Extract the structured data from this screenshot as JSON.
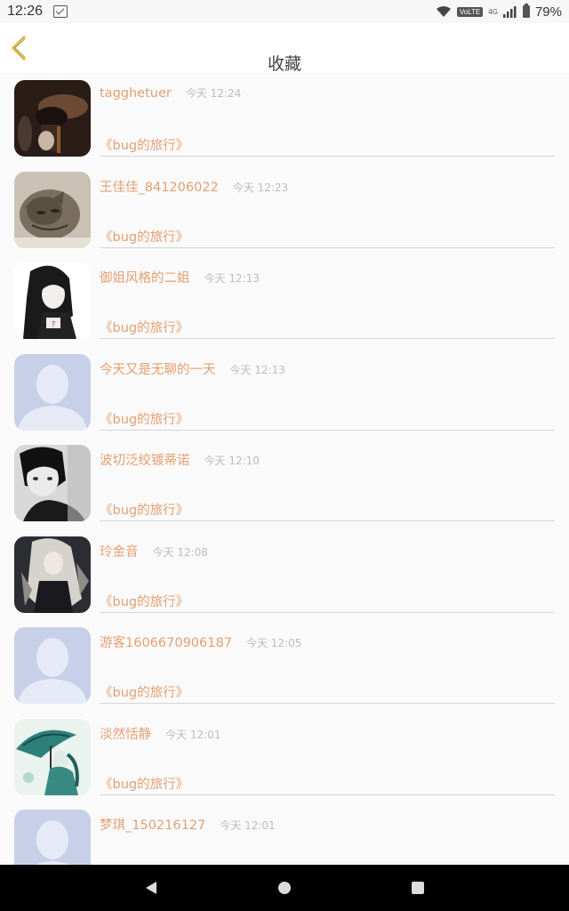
{
  "status_bar": {
    "time": "12:26",
    "volte": "VoLTE",
    "network": "4G",
    "battery": "79%",
    "icons": [
      "notification-icon",
      "wifi-icon",
      "signal-icon",
      "battery-icon"
    ]
  },
  "header": {
    "title": "收藏",
    "back_icon": "chevron-left-icon",
    "accent_color": "#d9b84a"
  },
  "colors": {
    "name_text": "#e3a073",
    "time_text": "#bdbdbd",
    "divider": "#d6d6d6",
    "background": "#fafafa"
  },
  "items": [
    {
      "name": "tagghetuer",
      "time": "今天 12:24",
      "book": "《bug的旅行》",
      "avatar": "dark-photo-avatar"
    },
    {
      "name": "王佳佳_841206022",
      "time": "今天 12:23",
      "book": "《bug的旅行》",
      "avatar": "cat-photo-avatar"
    },
    {
      "name": "御姐风格的二姐",
      "time": "今天 12:13",
      "book": "《bug的旅行》",
      "avatar": "anime-girl-avatar"
    },
    {
      "name": "今天又是无聊的一天",
      "time": "今天 12:13",
      "book": "《bug的旅行》",
      "avatar": "default-avatar"
    },
    {
      "name": "波切泛绞镀蒂诺",
      "time": "今天 12:10",
      "book": "《bug的旅行》",
      "avatar": "bw-portrait-avatar"
    },
    {
      "name": "玲金音",
      "time": "今天 12:08",
      "book": "《bug的旅行》",
      "avatar": "anime-silver-hair-avatar"
    },
    {
      "name": "游客1606670906187",
      "time": "今天 12:05",
      "book": "《bug的旅行》",
      "avatar": "default-avatar"
    },
    {
      "name": "淡然恬静",
      "time": "今天 12:01",
      "book": "《bug的旅行》",
      "avatar": "umbrella-art-avatar"
    },
    {
      "name": "梦琪_150216127",
      "time": "今天 12:01",
      "book": "",
      "avatar": "default-avatar"
    }
  ],
  "nav_bar": {
    "buttons": [
      "back-triangle-icon",
      "home-circle-icon",
      "recents-square-icon"
    ]
  }
}
